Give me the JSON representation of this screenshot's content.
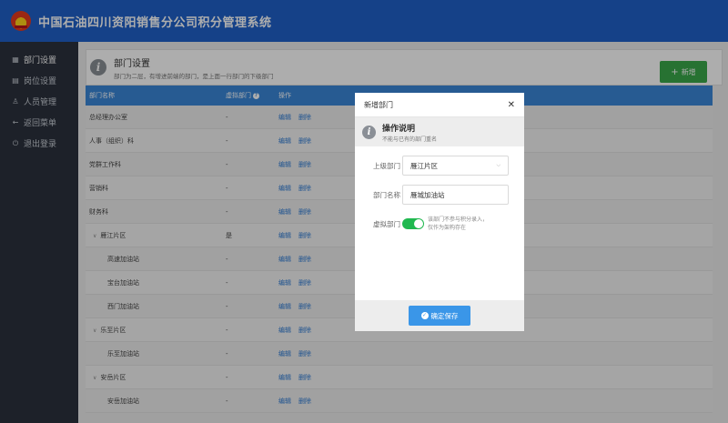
{
  "app": {
    "title": "中国石油四川资阳销售分公司积分管理系统"
  },
  "sidebar": {
    "items": [
      {
        "icon": "table-icon",
        "label": "部门设置",
        "active": true
      },
      {
        "icon": "document-icon",
        "label": "岗位设置",
        "active": false
      },
      {
        "icon": "user-icon",
        "label": "人员管理",
        "active": false
      },
      {
        "icon": "arrow-left-icon",
        "label": "返回菜单",
        "active": false
      },
      {
        "icon": "power-icon",
        "label": "退出登录",
        "active": false
      }
    ]
  },
  "page": {
    "title": "部门设置",
    "subtitle": "部门为二层，有增进前端的部门，是上面一行部门的下级部门",
    "add_label": "新增"
  },
  "table": {
    "headers": [
      "部门名称",
      "虚拟部门",
      "操作"
    ],
    "edit_label": "编辑",
    "delete_label": "删除",
    "rows": [
      {
        "name": "总经理办公室",
        "virtual": "-"
      },
      {
        "name": "人事（组织）科",
        "virtual": "-"
      },
      {
        "name": "党群工作科",
        "virtual": "-"
      },
      {
        "name": "营销科",
        "virtual": "-"
      },
      {
        "name": "财务科",
        "virtual": "-"
      },
      {
        "name": "雁江片区",
        "virtual": "是"
      },
      {
        "name": "高速加油站",
        "virtual": "-"
      },
      {
        "name": "宝台加油站",
        "virtual": "-"
      },
      {
        "name": "西门加油站",
        "virtual": "-"
      },
      {
        "name": "乐至片区",
        "virtual": "-"
      },
      {
        "name": "乐至加油站",
        "virtual": "-"
      },
      {
        "name": "安岳片区",
        "virtual": "-"
      },
      {
        "name": "安岳加油站",
        "virtual": "-"
      }
    ]
  },
  "modal": {
    "title": "新增部门",
    "close": "✕",
    "notice_title": "操作说明",
    "notice_sub": "不能与已有的部门重名",
    "parent_label": "上级部门",
    "parent_value": "雁江片区",
    "name_label": "部门名称",
    "name_value": "雁城加油站",
    "virtual_label": "虚拟部门",
    "virtual_on": true,
    "virtual_hint_1": "该部门不参与积分录入，",
    "virtual_hint_2": "仅作为架构存在",
    "save_label": "确定保存"
  }
}
